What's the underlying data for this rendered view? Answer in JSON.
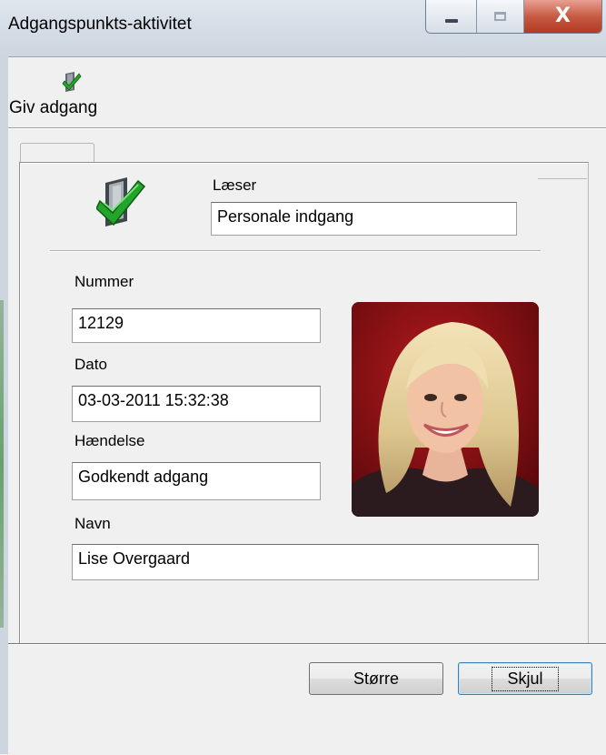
{
  "window": {
    "title": "Adgangspunkts-aktivitet",
    "close_glyph": "X"
  },
  "toolbar": {
    "grant_access_label": "Giv adgang",
    "grant_access_icon": "check-door-icon"
  },
  "reader": {
    "label": "Læser",
    "value": "Personale indgang",
    "icon": "check-door-icon"
  },
  "fields": {
    "number_label": "Nummer",
    "number_value": "12129",
    "date_label": "Dato",
    "date_value": "03-03-2011 15:32:38",
    "event_label": "Hændelse",
    "event_value": "Godkendt adgang",
    "name_label": "Navn",
    "name_value": "Lise Overgaard"
  },
  "buttons": {
    "larger_label": "Større",
    "hide_label": "Skjul"
  },
  "colors": {
    "photo_background": "#7a0f12",
    "check_green": "#22a52a"
  }
}
